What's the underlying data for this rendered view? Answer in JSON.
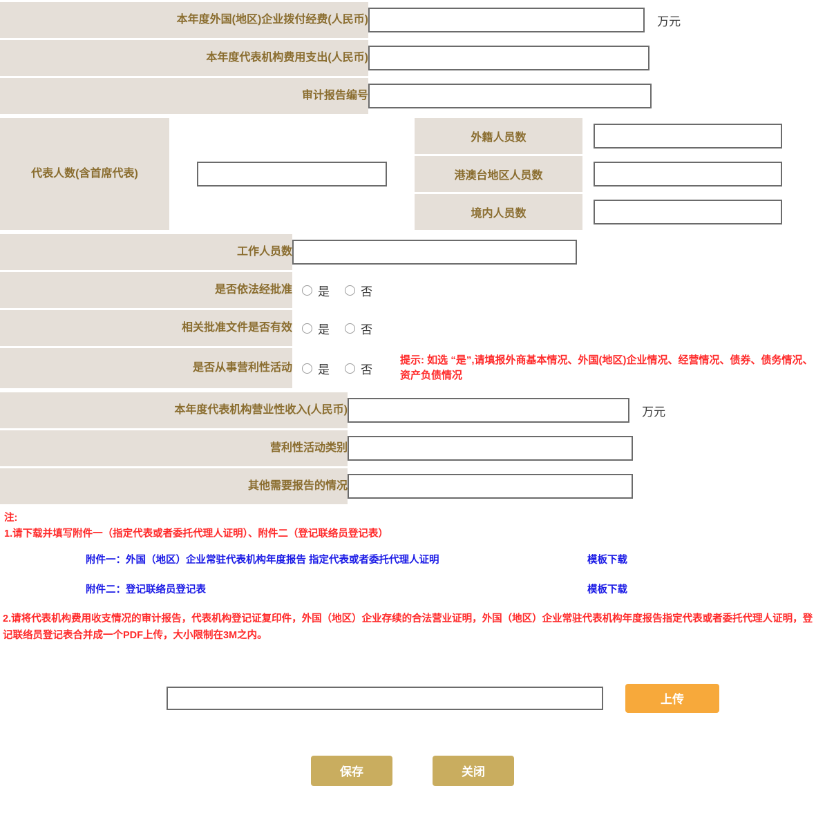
{
  "colors": {
    "label_bg": "#e5dfd8",
    "label_text": "#8a6d2f",
    "hint_red": "#ff2a2a",
    "link_blue": "#1a1ae6",
    "upload_orange": "#f7a93b",
    "footer_gold": "#c9ad5f",
    "input_border": "#6b6b6b"
  },
  "rows": {
    "foreign_funding": {
      "label": "本年度外国(地区)企业拨付经费(人民币)",
      "value": "",
      "unit": "万元"
    },
    "rep_office_expense": {
      "label": "本年度代表机构费用支出(人民币)",
      "value": ""
    },
    "audit_report_no": {
      "label": "审计报告编号",
      "value": ""
    },
    "staff_count": {
      "label": "工作人员数",
      "value": ""
    },
    "business_income": {
      "label": "本年度代表机构营业性收入(人民币)",
      "value": "",
      "unit": "万元"
    },
    "profit_activity_type": {
      "label": "营利性活动类别",
      "value": ""
    },
    "other_report": {
      "label": "其他需要报告的情况",
      "value": ""
    }
  },
  "representatives": {
    "label": "代表人数(含首席代表)",
    "value": "",
    "sub_rows": [
      {
        "label": "外籍人员数",
        "value": ""
      },
      {
        "label": "港澳台地区人员数",
        "value": ""
      },
      {
        "label": "境内人员数",
        "value": ""
      }
    ]
  },
  "radio_rows": [
    {
      "label": "是否依法经批准",
      "options": [
        {
          "label": "是",
          "selected": false
        },
        {
          "label": "否",
          "selected": false
        }
      ],
      "hint": ""
    },
    {
      "label": "相关批准文件是否有效",
      "options": [
        {
          "label": "是",
          "selected": false
        },
        {
          "label": "否",
          "selected": false
        }
      ],
      "hint": ""
    },
    {
      "label": "是否从事营利性活动",
      "options": [
        {
          "label": "是",
          "selected": false
        },
        {
          "label": "否",
          "selected": false
        }
      ],
      "hint": "提示: 如选 “是”,请填报外商基本情况、外国(地区)企业情况、经营情况、债券、债务情况、资产负债情况"
    }
  ],
  "notes": {
    "heading": "注:",
    "note1": "1.请下载并填写附件一（指定代表或者委托代理人证明）、附件二（登记联络员登记表）",
    "attachments": [
      {
        "title": "附件一：外国（地区）企业常驻代表机构年度报告 指定代表或者委托代理人证明",
        "download_label": "模板下载"
      },
      {
        "title": "附件二：登记联络员登记表",
        "download_label": "模板下载"
      }
    ],
    "note2": "2.请将代表机构费用收支情况的审计报告，代表机构登记证复印件，外国（地区）企业存续的合法营业证明，外国（地区）企业常驻代表机构年度报告指定代表或者委托代理人证明，登记联络员登记表合并成一个PDF上传，大小限制在3M之内。"
  },
  "upload": {
    "file_value": "",
    "button_label": "上传"
  },
  "footer": {
    "save_label": "保存",
    "close_label": "关闭"
  }
}
